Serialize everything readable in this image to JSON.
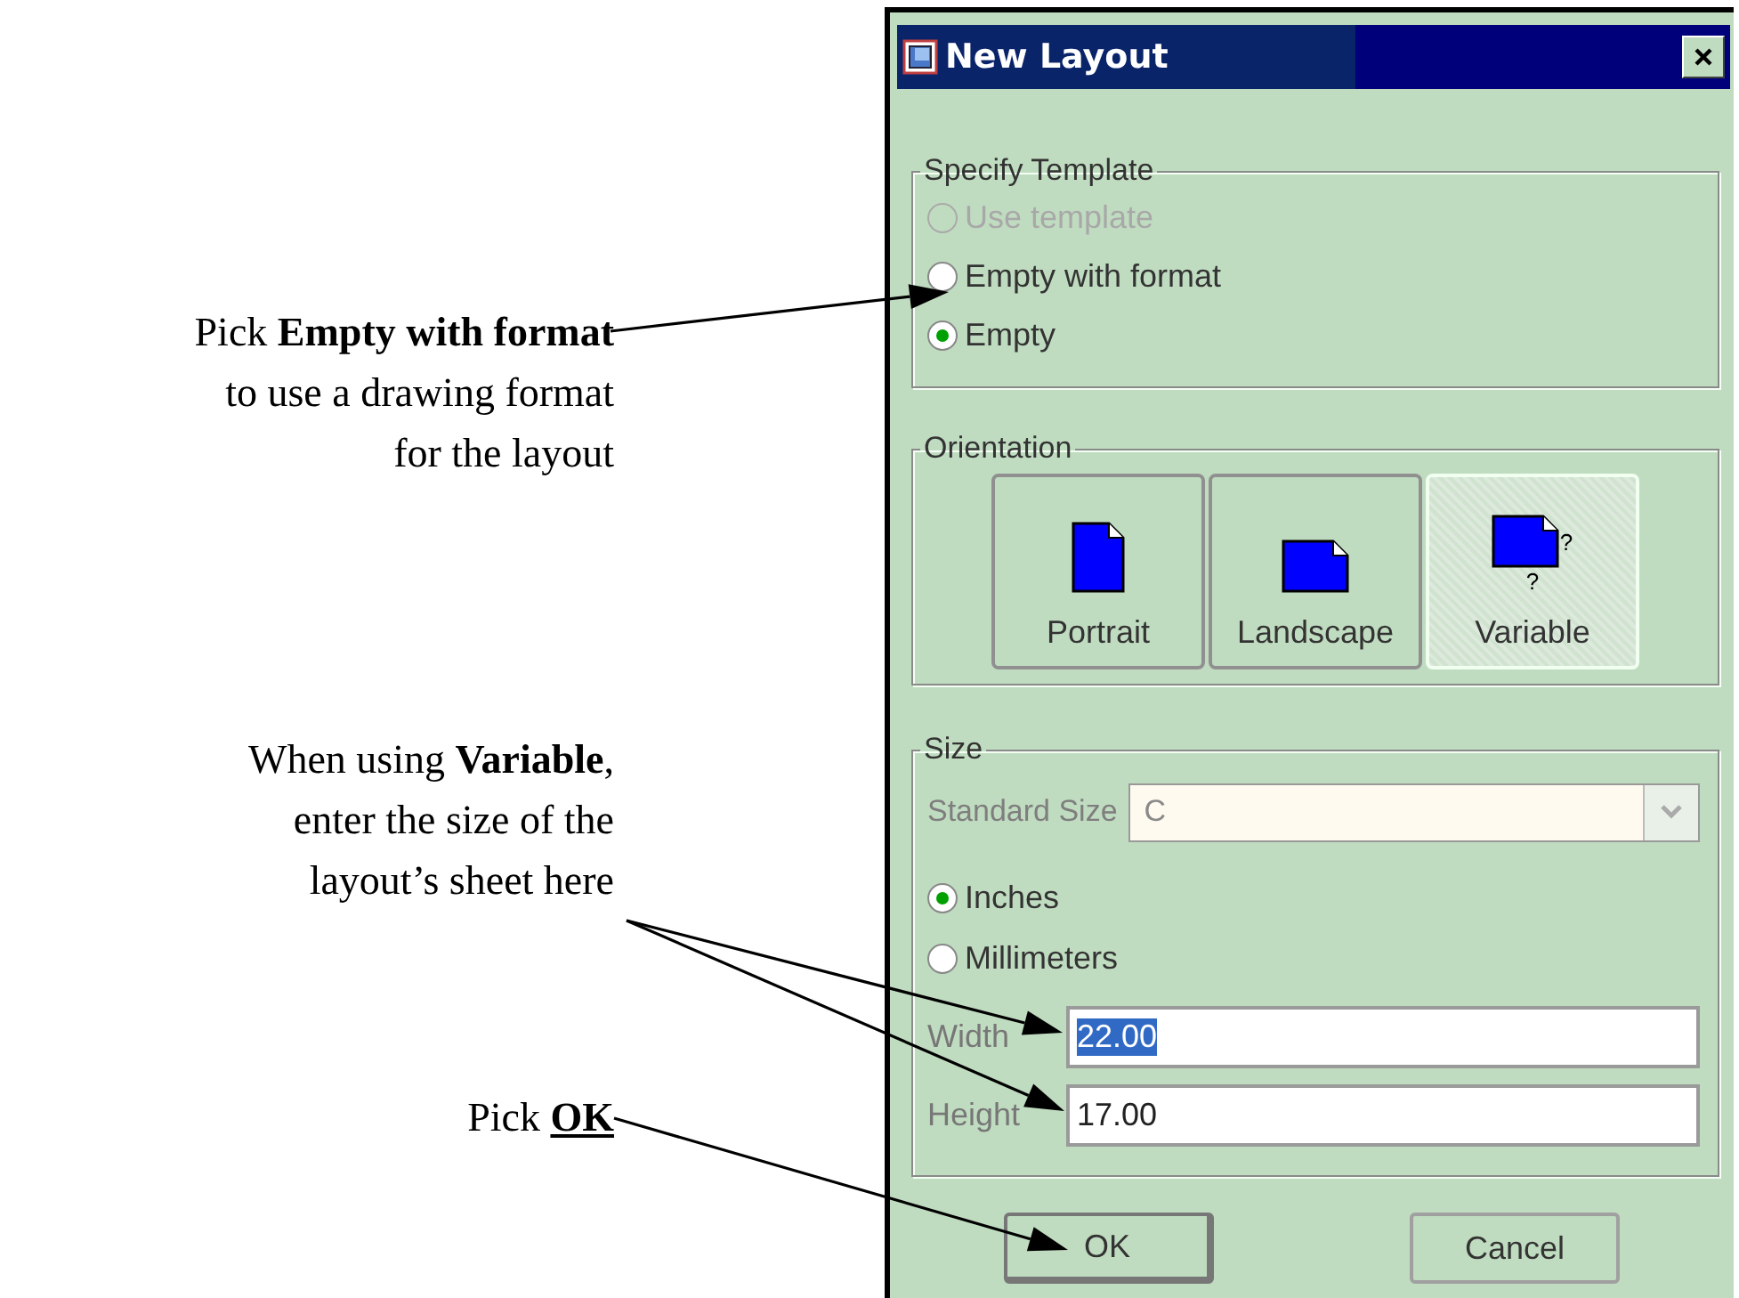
{
  "callouts": [
    {
      "lines": [
        "Pick **Empty with format**",
        "to use a drawing format",
        "for the layout"
      ],
      "underline_bold": false
    },
    {
      "lines": [
        "When using **Variable**,",
        "enter the size of the",
        "layout’s sheet here"
      ],
      "underline_bold": false
    },
    {
      "lines": [
        "Pick **OK**"
      ],
      "underline_bold": true
    }
  ],
  "window": {
    "title": "New Layout"
  },
  "template_group": {
    "label": "Specify Template",
    "options": [
      {
        "label": "Use template",
        "selected": false,
        "disabled": true
      },
      {
        "label": "Empty with format",
        "selected": false,
        "disabled": false
      },
      {
        "label": "Empty",
        "selected": true,
        "disabled": false
      }
    ]
  },
  "orientation_group": {
    "label": "Orientation",
    "options": [
      {
        "label": "Portrait",
        "kind": "portrait",
        "selected": false
      },
      {
        "label": "Landscape",
        "kind": "landscape",
        "selected": false
      },
      {
        "label": "Variable",
        "kind": "variable",
        "selected": true,
        "marks": [
          "?",
          "?"
        ]
      }
    ]
  },
  "size_group": {
    "label": "Size",
    "standard_size": {
      "label": "Standard Size",
      "value": "C",
      "disabled": true
    },
    "units": [
      {
        "label": "Inches",
        "selected": true,
        "disabled": false
      },
      {
        "label": "Millimeters",
        "selected": false,
        "disabled": false
      }
    ],
    "width": {
      "label": "Width",
      "value": "22.00",
      "highlighted": true
    },
    "height": {
      "label": "Height",
      "value": "17.00",
      "highlighted": false
    }
  },
  "buttons": [
    {
      "label": "OK",
      "default": true
    },
    {
      "label": "Cancel",
      "default": false
    }
  ]
}
